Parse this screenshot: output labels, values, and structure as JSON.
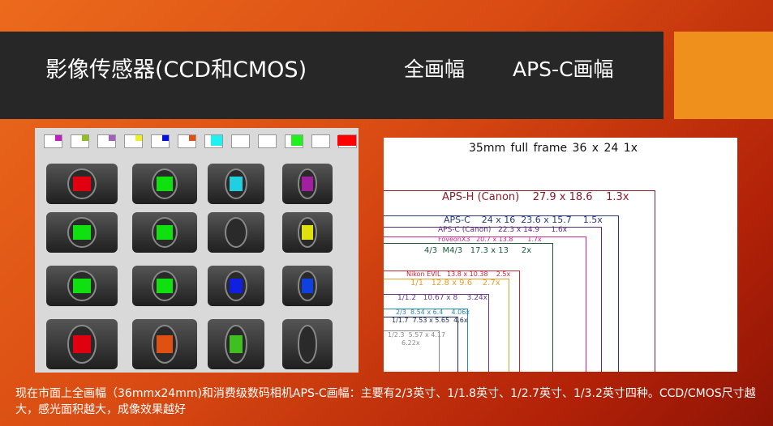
{
  "title": "影像传感器(CCD和CMOS)",
  "header_options": [
    "全画幅",
    "APS-C画幅"
  ],
  "legend_colors": [
    "#c020c0",
    "#90c020",
    "#a060c0",
    "#f0f020",
    "#0010e0",
    "#e05010",
    "#20f0f0",
    "#ffffff",
    "#ffffff",
    "#20f020",
    "#ffffff",
    "#ff0000"
  ],
  "cameras": [
    [
      "#e00010",
      "#10e010",
      "#20d0e0",
      "#a020a0"
    ],
    [
      "#10e010",
      "#10e010",
      "",
      "#e0e010"
    ],
    [
      "#10e010",
      "#10e010",
      "#1020e0",
      "#1040e0"
    ],
    [
      "#e00010",
      "#e05010",
      "#40c020",
      ""
    ]
  ],
  "sensor_diagram": {
    "full_frame": "35mm full frame    36 x 24     1x",
    "formats": [
      {
        "label": "APS-H (Canon)    27.9 x 18.6    1.3x",
        "color": "#8b1a2a"
      },
      {
        "label": "APS-C    24 x 16  23.6 x 15.7    1.5x",
        "color": "#2a3a7a"
      },
      {
        "label": "APS-C (Canon)   22.3 x 14.9     1.6x",
        "color": "#5a2a7a"
      },
      {
        "label": "FoveonX3   20.7 x 13.8       1.7x",
        "color": "#c02a8a"
      },
      {
        "label": "4/3  M4/3   17.3 x 13     2x",
        "color": "#1a5a3a"
      },
      {
        "label": "Nikon EVIL   13.8 x 10.38    2.5x",
        "color": "#c0283a"
      },
      {
        "label": "1/1   12.8 x 9.6    2.7x",
        "color": "#e0a030"
      },
      {
        "label": "1/1.2   10.67 x 8    3.24x",
        "color": "#6a3a8a"
      },
      {
        "label": "2/3  8.54 x 6.4    4.06x",
        "color": "#2a8aaa"
      },
      {
        "label": "1/1.7  7.53 x 5.65  4.6x",
        "color": "#1a2a5a"
      },
      {
        "label": "1/2.3  5.57 x 4.17",
        "color": "#888888",
        "extra": "6.22x"
      }
    ]
  },
  "caption": "现在市面上全画幅（36mmx24mm)和消费级数码相机APS-C画幅：主要有2/3英寸、1/1.8英寸、1/2.7英寸、1/3.2英寸四种。CCD/CMOS尺寸越大，感光面积越大，成像效果越好"
}
